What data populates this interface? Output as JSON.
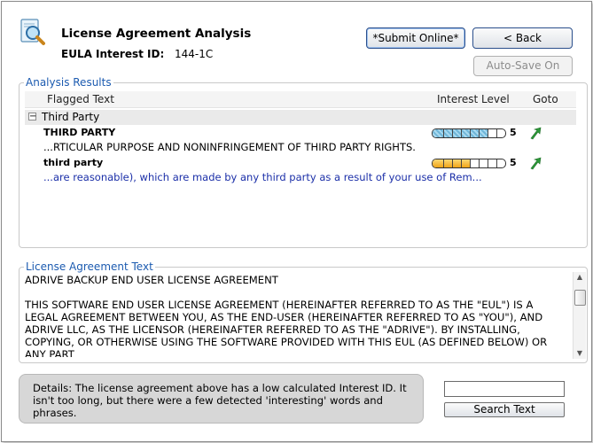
{
  "header": {
    "title": "License Agreement Analysis",
    "eula_label": "EULA Interest ID:",
    "eula_value": "144-1C",
    "icon": "document-magnifier-icon"
  },
  "buttons": {
    "submit_online": "*Submit Online*",
    "back": "< Back",
    "auto_save": "Auto-Save On"
  },
  "analysis": {
    "legend": "Analysis Results",
    "columns": {
      "flagged_text": "Flagged Text",
      "interest_level": "Interest Level",
      "goto": "Goto"
    },
    "group": {
      "expander": "−",
      "label": "Third Party"
    },
    "rows": [
      {
        "flag": "THIRD PARTY",
        "snippet": "...RTICULAR PURPOSE AND NONINFRINGEMENT OF THIRD PARTY RIGHTS.",
        "level": "5",
        "meter_color": "#7fc0dd",
        "goto_icon": "goto-arrow-icon"
      },
      {
        "flag": "third party",
        "snippet": "...are reasonable), which are made by any third party as a result of your use of Rem...",
        "level": "5",
        "meter_color": "#f0b429",
        "goto_icon": "goto-arrow-icon"
      }
    ]
  },
  "license": {
    "legend": "License Agreement Text",
    "text": "ADRIVE BACKUP END USER LICENSE AGREEMENT\n\nTHIS SOFTWARE END USER LICENSE AGREEMENT (HEREINAFTER REFERRED TO AS THE \"EUL\") IS A LEGAL AGREEMENT BETWEEN YOU, AS THE END-USER (HEREINAFTER REFERRED TO AS \"YOU\"), AND ADRIVE LLC, AS THE LICENSOR (HEREINAFTER REFERRED TO AS THE \"ADRIVE\"). BY INSTALLING, COPYING, OR OTHERWISE USING THE SOFTWARE PROVIDED WITH THIS EUL (AS DEFINED BELOW) OR ANY PART"
  },
  "details": {
    "text": "Details: The license agreement above has a low calculated Interest ID. It isn't too long, but there were a few detected 'interesting' words and phrases."
  },
  "search": {
    "value": "",
    "button": "Search Text"
  }
}
